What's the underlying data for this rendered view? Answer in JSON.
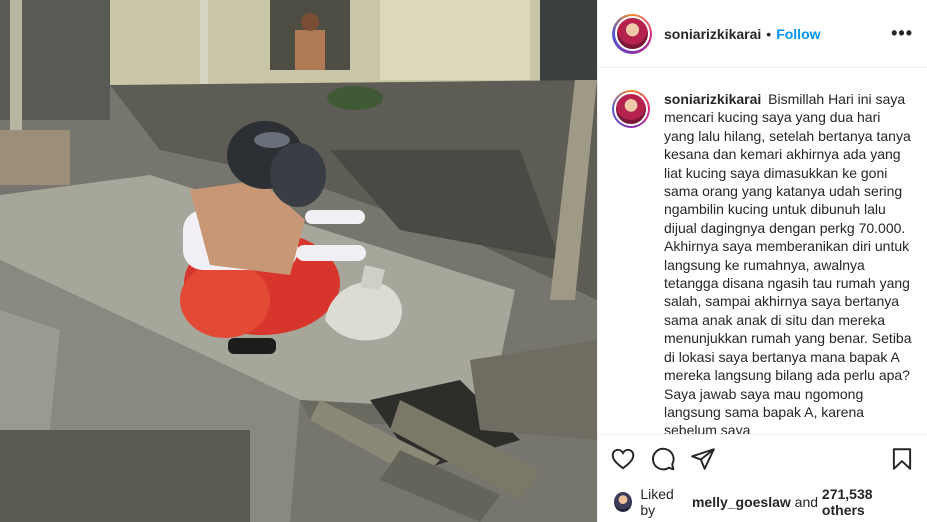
{
  "header": {
    "username": "soniarizkikarai",
    "separator": "•",
    "follow_label": "Follow",
    "more_label": "•••"
  },
  "caption": {
    "username": "soniarizkikarai",
    "text": "Bismillah Hari ini saya mencari kucing saya yang dua hari yang lalu hilang, setelah bertanya tanya kesana dan kemari akhirnya ada yang liat kucing saya dimasukkan ke goni sama orang yang katanya udah sering ngambilin kucing untuk dibunuh lalu dijual dagingnya dengan perkg 70.000. Akhirnya saya memberanikan diri untuk langsung ke rumahnya, awalnya tetangga disana ngasih tau rumah yang salah, sampai akhirnya saya bertanya sama anak anak di situ dan mereka menunjukkan rumah yang benar. Setiba di lokasi saya bertanya mana bapak A mereka langsung bilang ada perlu apa? Saya jawab saya mau ngomong langsung sama bapak A, karena sebelum saya"
  },
  "actions": {
    "like_icon": "heart-icon",
    "comment_icon": "comment-icon",
    "share_icon": "paper-plane-icon",
    "save_icon": "bookmark-icon"
  },
  "likes": {
    "prefix": "Liked by",
    "liker": "melly_goeslaw",
    "connector": "and",
    "others": "271,538 others"
  }
}
